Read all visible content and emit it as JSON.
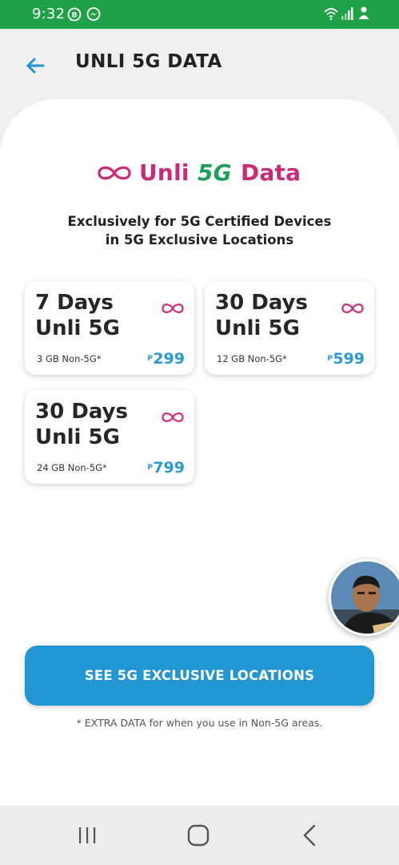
{
  "status_bar": {
    "time": "9:32",
    "icons": [
      "whatsapp-business-icon",
      "messenger-icon",
      "wifi-icon",
      "signal-icon",
      "notification-person-icon"
    ],
    "color": "#1fa246"
  },
  "header": {
    "title": "UNLI 5G DATA",
    "back_icon": "arrow-left-icon"
  },
  "logo": {
    "symbol": "infinity-icon",
    "unli": "Unli",
    "five_g": "5G",
    "data": "Data"
  },
  "subtitle": {
    "line1": "Exclusively for 5G Certified Devices",
    "line2": "in 5G Exclusive Locations"
  },
  "plans": [
    {
      "days": "7 Days",
      "name": "Unli 5G",
      "extra": "3 GB Non-5G*",
      "currency": "P",
      "price": "299"
    },
    {
      "days": "30 Days",
      "name": "Unli 5G",
      "extra": "12 GB Non-5G*",
      "currency": "P",
      "price": "599"
    },
    {
      "days": "30 Days",
      "name": "Unli 5G",
      "extra": "24 GB Non-5G*",
      "currency": "P",
      "price": "799"
    }
  ],
  "cta": {
    "label": "SEE 5G EXCLUSIVE LOCATIONS"
  },
  "footnote": "* EXTRA DATA for when you use in Non-5G areas.",
  "navbar": {
    "icons": [
      "recent-apps-icon",
      "home-icon",
      "back-icon"
    ]
  },
  "colors": {
    "accent_pink": "#cc2a78",
    "accent_green": "#1da15a",
    "price_blue": "#2b9ad3",
    "button_blue": "#2196d3"
  }
}
